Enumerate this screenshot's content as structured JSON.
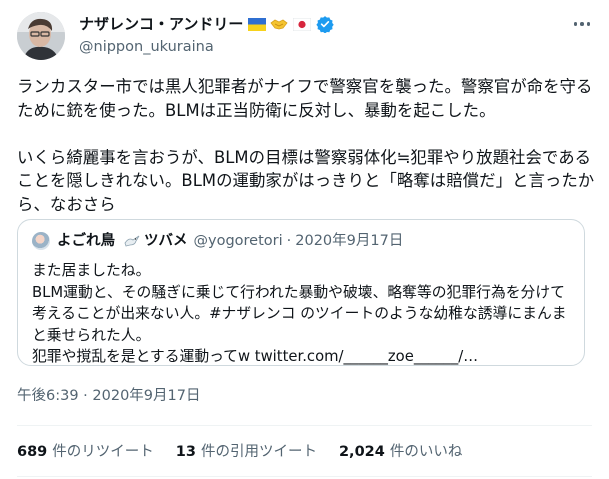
{
  "author": {
    "name": "ナザレンコ・アンドリー",
    "handle": "@nippon_ukuraina"
  },
  "tweet": {
    "text": "ランカスター市では黒人犯罪者がナイフで警察官を襲った。警察官が命を守るために銃を使った。BLMは正当防衛に反対し、暴動を起こした。\n\nいくら綺麗事を言おうが、BLMの目標は警察弱体化≒犯罪やり放題社会であることを隠しきれない。BLMの運動家がはっきりと「略奪は賠償だ」と言ったから、なおさら"
  },
  "quoted": {
    "name_part1": "よごれ鳥",
    "name_part2": "ツバメ",
    "handle": "@yogoretori",
    "separator": "·",
    "date": "2020年9月17日",
    "text": "また居ましたね。\nBLM運動と、その騒ぎに乗じて行われた暴動や破壊、略奪等の犯罪行為を分けて考えることが出来ない人。#ナザレンコ のツイートのような幼稚な誘導にまんまと乗せられた人。\n犯罪や撹乱を是とする運動ってw twitter.com/______zoe______/…"
  },
  "meta": {
    "timestamp": "午後6:39 · 2020年9月17日"
  },
  "stats": {
    "retweets": "689",
    "retweets_label": "件のリツイート",
    "quotes": "13",
    "quotes_label": "件の引用ツイート",
    "likes": "2,024",
    "likes_label": "件のいいね"
  },
  "icons": [
    "avatar",
    "ukraine-flag-icon",
    "handshake-icon",
    "japan-flag-icon",
    "verified-icon",
    "more-icon",
    "dove-icon"
  ],
  "colors": {
    "secondary_text": "#536471",
    "verified": "#1d9bf0",
    "border": "#cfd9de"
  }
}
